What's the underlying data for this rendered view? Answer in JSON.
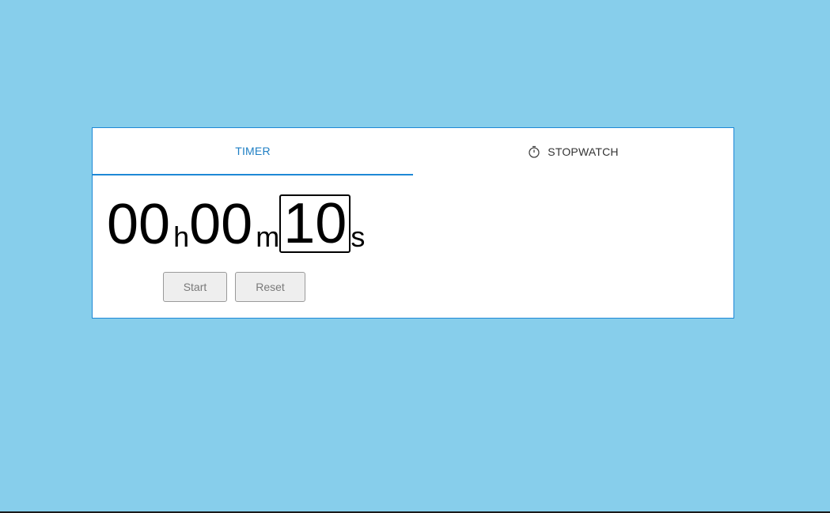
{
  "tabs": [
    {
      "label": "TIMER",
      "active": true
    },
    {
      "label": "STOPWATCH",
      "active": false,
      "icon": "stopwatch-icon"
    }
  ],
  "timer": {
    "hours": "00",
    "hours_unit": "h",
    "minutes": "00",
    "minutes_unit": "m",
    "seconds": "10",
    "seconds_unit": "s"
  },
  "buttons": {
    "start_label": "Start",
    "reset_label": "Reset"
  },
  "colors": {
    "background": "#87ceeb",
    "accent": "#1e88d6",
    "active_tab_text": "#1f7fc4"
  }
}
